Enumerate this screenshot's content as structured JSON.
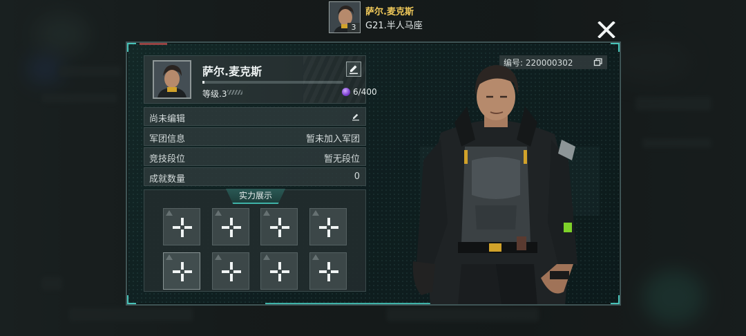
{
  "header": {
    "player_name": "萨尔.麦克斯",
    "subtitle": "G21.半人马座",
    "avatar_level": "3",
    "close_icon": "close-x-icon"
  },
  "profile": {
    "name": "萨尔.麦克斯",
    "level_label": "等级.3",
    "xp_fraction": 0.015,
    "gem_count": "6/400",
    "gem_icon": "purple-gem-icon",
    "edit_icon": "pencil-icon",
    "id_label": "编号: 220000302",
    "copy_icon": "copy-icon"
  },
  "info_rows": [
    {
      "key": "尚未编辑",
      "value": ""
    },
    {
      "key": "军团信息",
      "value": "暂未加入军团"
    },
    {
      "key": "竞技段位",
      "value": "暂无段位"
    },
    {
      "key": "成就数量",
      "value": "0"
    }
  ],
  "showcase": {
    "title": "实力展示",
    "slot_icon": "plus-icon",
    "slot_count": 8
  },
  "colors": {
    "accent_teal": "#3fb3a8",
    "gold_name": "#f0c95a",
    "panel_bg": "#0f1f20"
  }
}
